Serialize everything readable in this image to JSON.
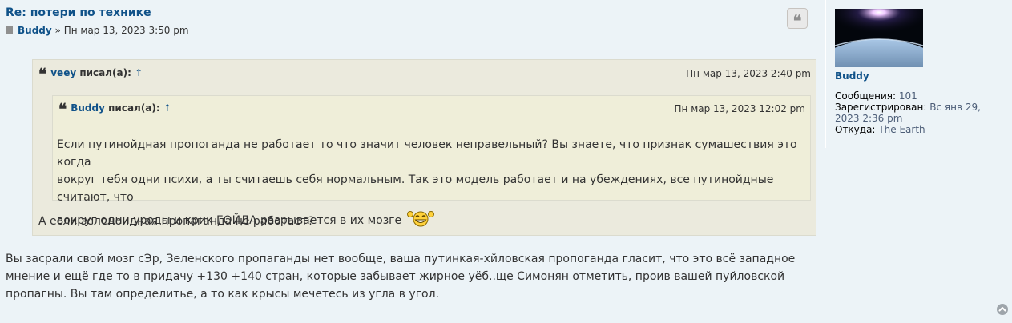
{
  "post": {
    "title": "Re: потери по технике",
    "author": "Buddy",
    "separator": "»",
    "date": "Пн мар 13, 2023 3:50 pm"
  },
  "quote_outer": {
    "user": "veey",
    "wrote": "писал(а):",
    "arrow": "↑",
    "date": "Пн мар 13, 2023 2:40 pm",
    "text": "А если зеленоидная пропаганда не работает?"
  },
  "quote_inner": {
    "user": "Buddy",
    "wrote": "писал(а):",
    "arrow": "↑",
    "date": "Пн мар 13, 2023 12:02 pm",
    "line1": "Если путинойдная пропоганда не работает то что значит человек неправельный? Вы знаете, что признак сумашествия это когда",
    "line2": "вокруг тебя одни психи, а ты считаешь себя нормальным. Так это модель работает и на убеждениях, все путинойдные считают, что",
    "line3": "вокруг одни уроды и крик ГОЙДА разрывается в их мозге"
  },
  "content": {
    "line1": "Вы засрали свой мозг сЭр, Зеленского пропаганды нет вообще, ваша путинкая-хйловская пропоганда гласит, что это всё западное",
    "line2": "мнение и ещё где то в придачу +130 +140 стран, которые забывает жирное уёб..ще Симонян отметить, проив вашей пуйловской",
    "line3": "пропагны. Вы там определитье, а то как крысы мечетесь из угла в угол."
  },
  "profile": {
    "name": "Buddy",
    "posts_label": "Сообщения:",
    "posts_value": "101",
    "registered_label": "Зарегистрирован:",
    "registered_value": "Вс янв 29, 2023 2:36 pm",
    "from_label": "Откуда:",
    "from_value": "The Earth"
  },
  "icons": {
    "post_icon": "document-icon",
    "quote_button": "quote-icon",
    "back_to_top": "chevron-up-icon",
    "smiley": "laughing-smiley-icon"
  },
  "colors": {
    "link": "#105289",
    "post_bg": "#ecf3f7",
    "quote_bg": "#ebeadd",
    "nested_quote_bg": "#efeed9"
  }
}
